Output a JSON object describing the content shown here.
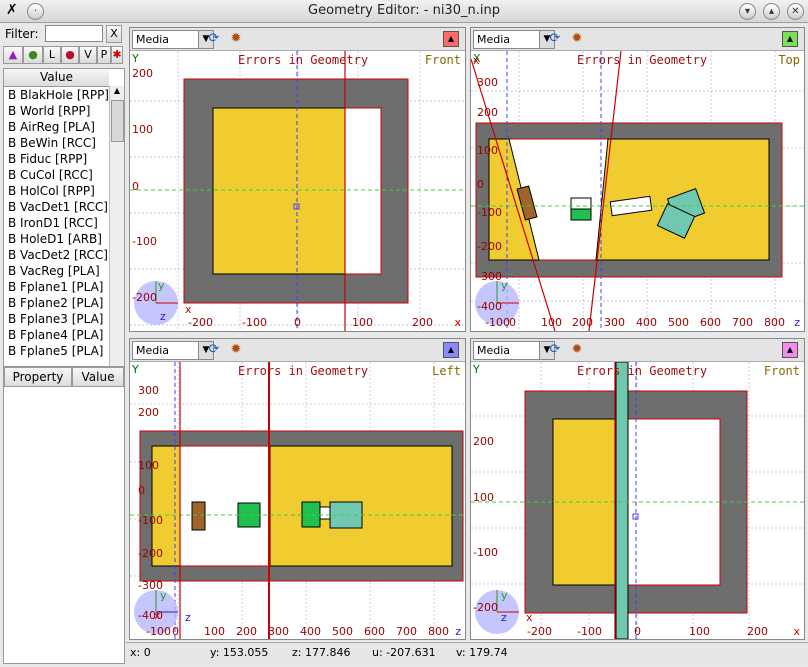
{
  "window": {
    "title": "Geometry Editor:   - ni30_n.inp"
  },
  "left": {
    "filter_label": "Filter:",
    "filter_value": "",
    "clear_label": "X",
    "toolbar": [
      "L",
      "V",
      "P"
    ],
    "list_header": "Value",
    "bodies": [
      "B BlakHole  [RPP]",
      "B World  [RPP]",
      "B AirReg  [PLA]",
      "B BeWin  [RCC]",
      "B Fiduc  [RPP]",
      "B CuCol  [RCC]",
      "B HolCol  [RPP]",
      "B VacDet1  [RCC]",
      "B IronD1  [RCC]",
      "B HoleD1  [ARB]",
      "B VacDet2  [RCC]",
      "B VacReg  [PLA]",
      "B Fplane1  [PLA]",
      "B Fplane2  [PLA]",
      "B Fplane3  [PLA]",
      "B Fplane4  [PLA]",
      "B Fplane5  [PLA]"
    ],
    "prop_header": "Property",
    "val_header": "Value"
  },
  "viewports": [
    {
      "media": "Media",
      "title": "Errors in Geometry",
      "label": "Front",
      "ylabel": "Y",
      "axis_z": "z",
      "axis_y": "y",
      "axis_x": "x",
      "color": "#ff6b6b",
      "xticks": [
        "-200",
        "-100",
        "0",
        "100",
        "200"
      ],
      "yticks": [
        "200",
        "100",
        "0",
        "-100",
        "-200"
      ]
    },
    {
      "media": "Media",
      "title": "Errors in Geometry",
      "label": "Top",
      "ylabel": "X",
      "axis_z": "z",
      "axis_y": "y",
      "axis_x": "x",
      "color": "#7ae05a",
      "xticks": [
        "-100",
        "0",
        "100",
        "200",
        "300",
        "400",
        "500",
        "600",
        "700",
        "800"
      ],
      "yticks": [
        "300",
        "200",
        "100",
        "0",
        "-100",
        "-200",
        "-300",
        "-400"
      ]
    },
    {
      "media": "Media",
      "title": "Errors in Geometry",
      "label": "Left",
      "ylabel": "Y",
      "axis_z": "z",
      "axis_y": "y",
      "axis_x": "x",
      "color": "#8a8aff",
      "xticks": [
        "-100",
        "0",
        "100",
        "200",
        "300",
        "400",
        "500",
        "600",
        "700",
        "800"
      ],
      "yticks": [
        "300",
        "200",
        "100",
        "0",
        "-100",
        "-200",
        "-300",
        "-400"
      ]
    },
    {
      "media": "Media",
      "title": "Errors in Geometry",
      "label": "Front",
      "ylabel": "Y",
      "axis_z": "z",
      "axis_y": "y",
      "axis_x": "x",
      "color": "#f48cf0",
      "xticks": [
        "-200",
        "-100",
        "0",
        "100",
        "200"
      ],
      "yticks": [
        "200",
        "100",
        "0",
        "-100",
        "-200"
      ]
    }
  ],
  "status": {
    "x": "x: 0",
    "y": "y: 153.055",
    "z": "z: 177.846",
    "u": "u: -207.631",
    "v": "v: 179.74"
  },
  "colors": {
    "yellow": "#f0cc30",
    "gray": "#6e6e6e",
    "red": "#cc0000",
    "green": "#20c050",
    "teal": "#70c8b0",
    "brown": "#a0642a"
  }
}
